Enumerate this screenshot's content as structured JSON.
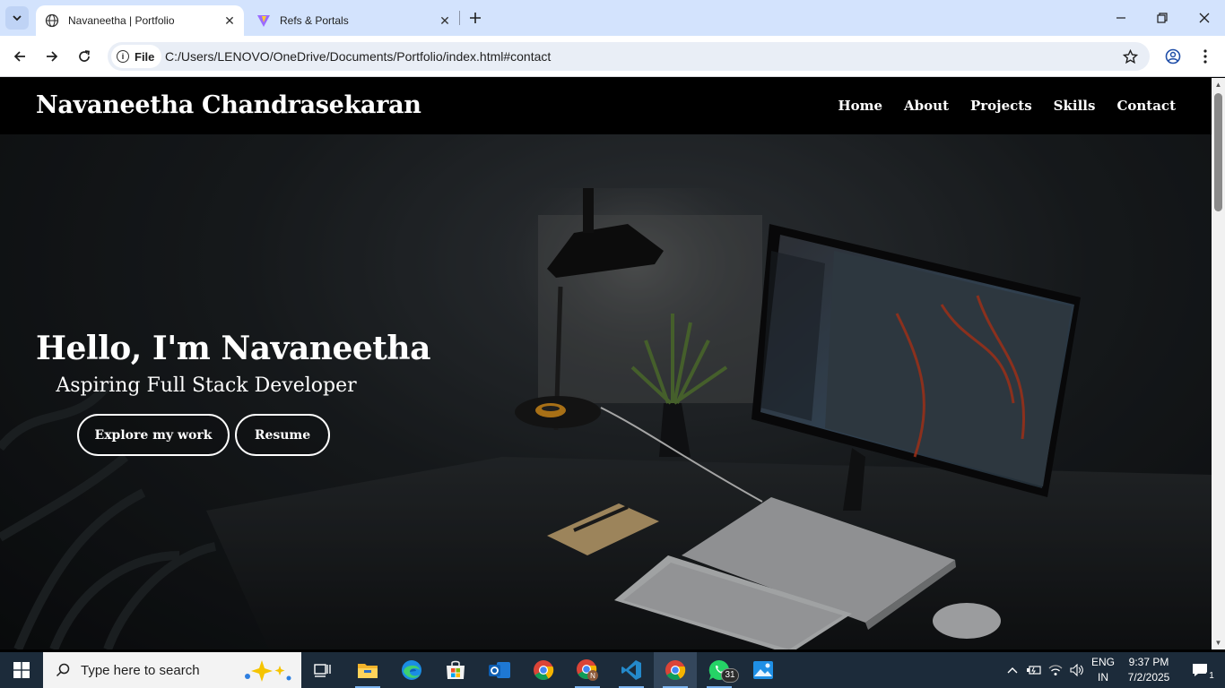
{
  "browser": {
    "tabs": [
      {
        "title": "Navaneetha | Portfolio",
        "active": true
      },
      {
        "title": "Refs & Portals",
        "active": false
      }
    ],
    "security_chip": "File",
    "url": "C:/Users/LENOVO/OneDrive/Documents/Portfolio/index.html#contact"
  },
  "site": {
    "brand": "Navaneetha Chandrasekaran",
    "nav": [
      "Home",
      "About",
      "Projects",
      "Skills",
      "Contact"
    ],
    "hero": {
      "title": "Hello, I'm Navaneetha",
      "subtitle": "Aspiring Full Stack Developer",
      "buttons": [
        "Explore my work",
        "Resume"
      ]
    }
  },
  "taskbar": {
    "search_placeholder": "Type here to search",
    "whatsapp_badge": "31",
    "language": [
      "ENG",
      "IN"
    ],
    "time": "9:37 PM",
    "date": "7/2/2025",
    "notification_count": "1"
  },
  "colors": {
    "tabbar": "#d3e3fd",
    "omnibox": "#e9eef6",
    "site_nav": "#000000",
    "taskbar": "#1c2b3a"
  }
}
